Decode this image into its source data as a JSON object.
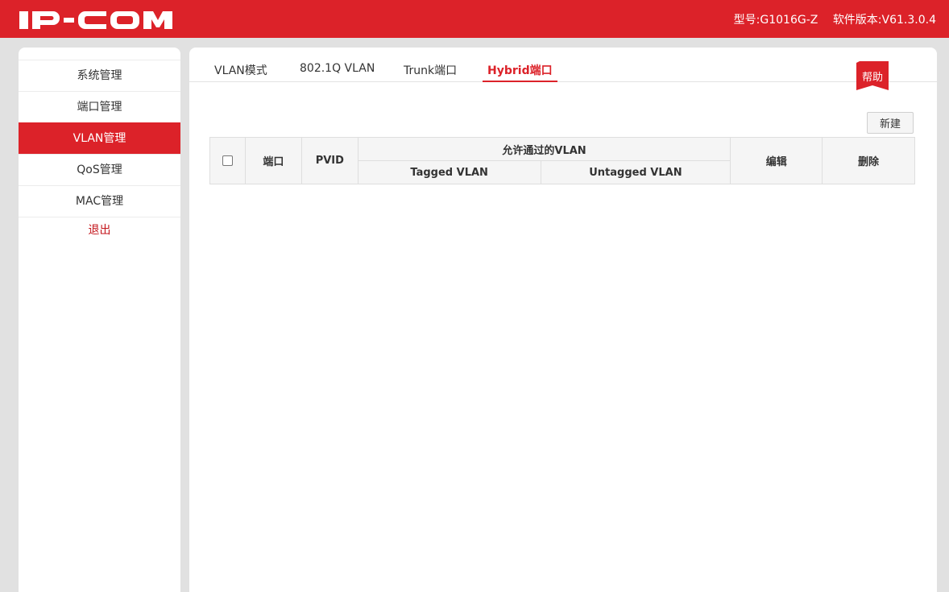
{
  "header": {
    "logo": "IP-COM",
    "model_label": "型号:G1016G-Z",
    "version_label": "软件版本:V61.3.0.4"
  },
  "sidebar": {
    "items": [
      {
        "label": "系统管理",
        "active": false
      },
      {
        "label": "端口管理",
        "active": false
      },
      {
        "label": "VLAN管理",
        "active": true
      },
      {
        "label": "QoS管理",
        "active": false
      },
      {
        "label": "MAC管理",
        "active": false
      }
    ],
    "logout": "退出"
  },
  "tabs": [
    {
      "label": "VLAN模式",
      "active": false
    },
    {
      "label": "802.1Q VLAN",
      "active": false
    },
    {
      "label": "Trunk端口",
      "active": false
    },
    {
      "label": "Hybrid端口",
      "active": true
    }
  ],
  "help_label": "帮助",
  "new_button": "新建",
  "table": {
    "col_port": "端口",
    "col_pvid": "PVID",
    "col_allowed": "允许通过的VLAN",
    "col_tagged": "Tagged VLAN",
    "col_untagged": "Untagged VLAN",
    "col_edit": "编辑",
    "col_delete": "删除",
    "rows": []
  },
  "colors": {
    "brand_red": "#dc2229",
    "background": "#e1e1e1"
  }
}
